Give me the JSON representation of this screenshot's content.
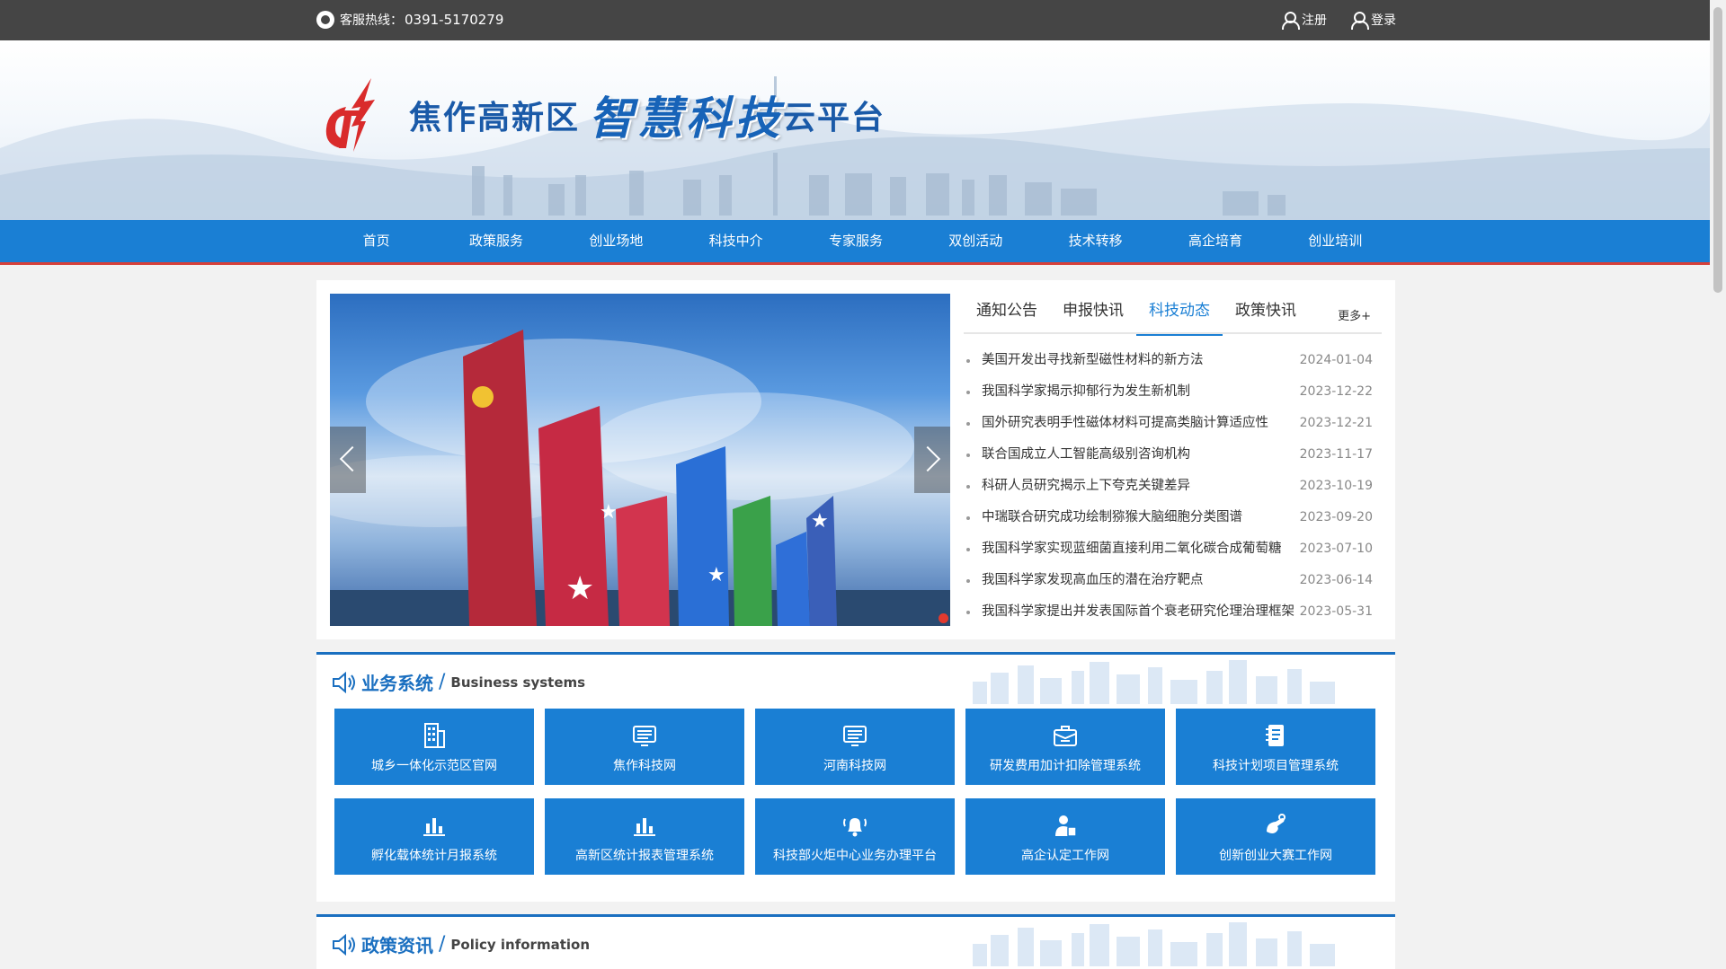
{
  "topbar": {
    "hotline_label": "客服热线：",
    "hotline_number": "0391-5170279",
    "register": "注册",
    "login": "登录"
  },
  "header": {
    "title_part1": "焦作高新区",
    "title_part2": "智慧科技",
    "title_part3": "云平台"
  },
  "nav": [
    "首页",
    "政策服务",
    "创业场地",
    "科技中介",
    "专家服务",
    "双创活动",
    "技术转移",
    "高企培育",
    "创业培训"
  ],
  "news": {
    "tabs": [
      "通知公告",
      "申报快讯",
      "科技动态",
      "政策快讯"
    ],
    "active_tab": "科技动态",
    "more": "更多+",
    "items": [
      {
        "title": "美国开发出寻找新型磁性材料的新方法",
        "date": "2024-01-04"
      },
      {
        "title": "我国科学家揭示抑郁行为发生新机制",
        "date": "2023-12-22"
      },
      {
        "title": "国外研究表明手性磁体材料可提高类脑计算适应性",
        "date": "2023-12-21"
      },
      {
        "title": "联合国成立人工智能高级别咨询机构",
        "date": "2023-11-17"
      },
      {
        "title": "科研人员研究揭示上下夸克关键差异",
        "date": "2023-10-19"
      },
      {
        "title": "中瑞联合研究成功绘制猕猴大脑细胞分类图谱",
        "date": "2023-09-20"
      },
      {
        "title": "我国科学家实现蓝细菌直接利用二氧化碳合成葡萄糖",
        "date": "2023-07-10"
      },
      {
        "title": "我国科学家发现高血压的潜在治疗靶点",
        "date": "2023-06-14"
      },
      {
        "title": "我国科学家提出并发表国际首个衰老研究伦理治理框架",
        "date": "2023-05-31"
      }
    ]
  },
  "business": {
    "title_cn": "业务系统",
    "title_en": "Business systems",
    "tiles": [
      {
        "label": "城乡一体化示范区官网",
        "icon": "building-icon"
      },
      {
        "label": "焦作科技网",
        "icon": "monitor-icon"
      },
      {
        "label": "河南科技网",
        "icon": "monitor-icon"
      },
      {
        "label": "研发费用加计扣除管理系统",
        "icon": "briefcase-icon"
      },
      {
        "label": "科技计划项目管理系统",
        "icon": "notebook-icon"
      },
      {
        "label": "孵化载体统计月报系统",
        "icon": "bar-chart-icon"
      },
      {
        "label": "高新区统计报表管理系统",
        "icon": "bar-chart-icon"
      },
      {
        "label": "科技部火炬中心业务办理平台",
        "icon": "bell-icon"
      },
      {
        "label": "高企认定工作网",
        "icon": "person-icon"
      },
      {
        "label": "创新创业大赛工作网",
        "icon": "hand-icon"
      }
    ]
  },
  "policy": {
    "title_cn": "政策资讯",
    "title_en": "Policy information"
  },
  "colors": {
    "primary": "#1a7fd4",
    "topbar": "#454545",
    "nav_border": "#d6403a",
    "section_border": "#1a6fc0"
  }
}
